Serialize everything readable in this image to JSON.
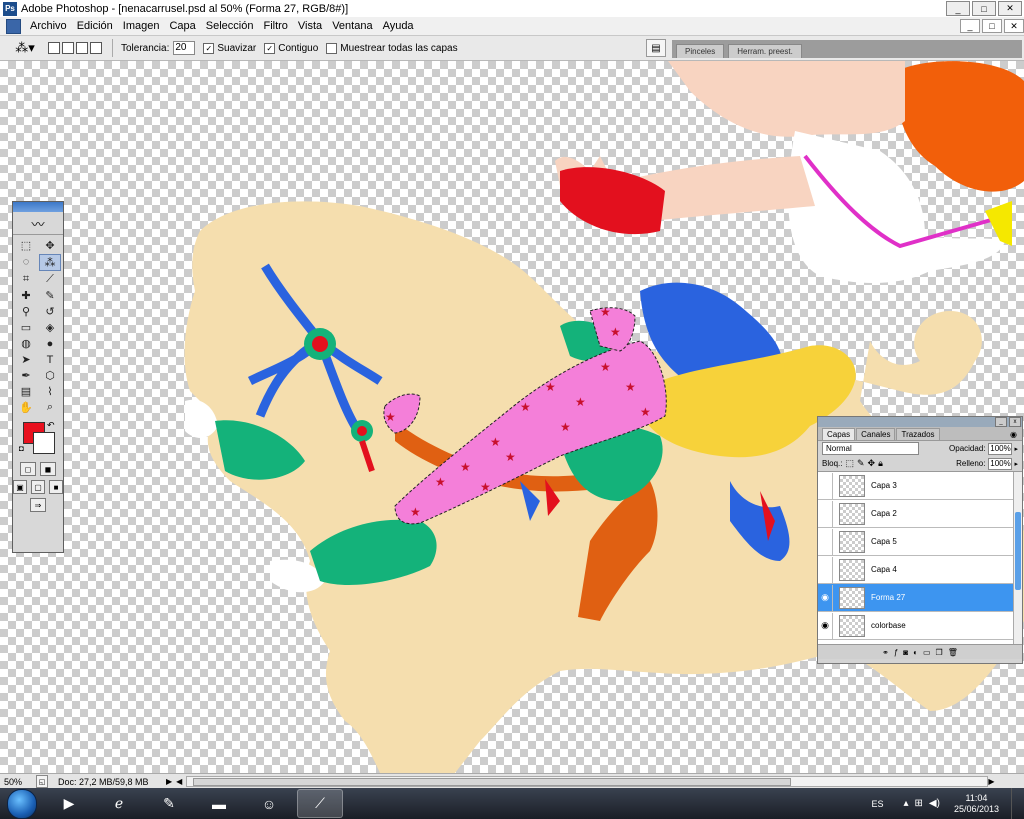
{
  "window": {
    "title": "Adobe Photoshop - [nenacarrusel.psd al 50% (Forma 27, RGB/8#)]",
    "controls": [
      "_",
      "□",
      "✕"
    ]
  },
  "menubar": {
    "items": [
      "Archivo",
      "Edición",
      "Imagen",
      "Capa",
      "Selección",
      "Filtro",
      "Vista",
      "Ventana",
      "Ayuda"
    ],
    "doc_controls": [
      "_",
      "□",
      "✕"
    ]
  },
  "options": {
    "tolerance_label": "Tolerancia:",
    "tolerance_value": "20",
    "smooth_label": "Suavizar",
    "smooth_checked": true,
    "contiguous_label": "Contiguo",
    "contiguous_checked": true,
    "sample_all_label": "Muestrear todas las capas",
    "sample_all_checked": false
  },
  "palette_well": {
    "tabs": [
      "Pinceles",
      "Herram. preest."
    ]
  },
  "toolbox": {
    "foreground_color": "#e8101e",
    "background_color": "#ffffff"
  },
  "layers_panel": {
    "tabs": [
      "Capas",
      "Canales",
      "Trazados"
    ],
    "blend_mode": "Normal",
    "opacity_label": "Opacidad:",
    "opacity_value": "100%",
    "lock_label": "Bloq.:",
    "fill_label": "Relleno:",
    "fill_value": "100%",
    "layers": [
      {
        "name": "Capa 3",
        "visible": false,
        "selected": false
      },
      {
        "name": "Capa 2",
        "visible": false,
        "selected": false
      },
      {
        "name": "Capa 5",
        "visible": false,
        "selected": false
      },
      {
        "name": "Capa 4",
        "visible": false,
        "selected": false
      },
      {
        "name": "Forma 27",
        "visible": true,
        "selected": true
      },
      {
        "name": "colorbase",
        "visible": true,
        "selected": false
      }
    ]
  },
  "status": {
    "zoom": "50%",
    "doc_info": "Doc: 27,2 MB/59,8 MB"
  },
  "taskbar": {
    "language": "ES",
    "time": "11:04",
    "date": "25/06/2013"
  },
  "colors": {
    "horse": "#f5deae",
    "pink": "#f47fd9",
    "blue": "#2a63df",
    "green": "#14b27a",
    "orange_hair": "#f25f0a",
    "red": "#e3101e",
    "skin": "#f8d4c1",
    "yellow": "#f7d23a",
    "rust": "#e06012",
    "selected_layer": "#3d95f0"
  }
}
